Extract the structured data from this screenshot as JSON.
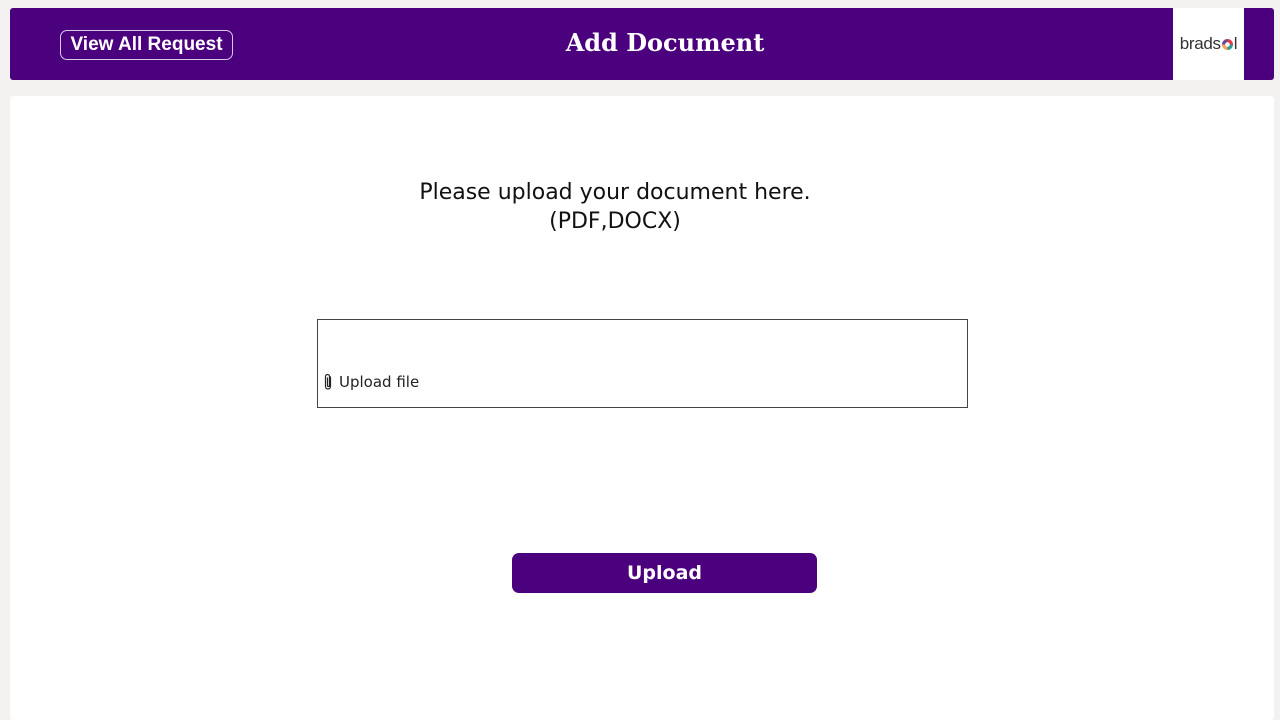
{
  "header": {
    "title": "Add Document",
    "view_all_label": "View All Request",
    "logo_text_before": "brads",
    "logo_text_after": "l",
    "background_color": "#4b007d"
  },
  "main": {
    "prompt_line1": "Please upload your document here.",
    "prompt_line2": "(PDF,DOCX)",
    "upload_file_label": "Upload file",
    "upload_button_label": "Upload"
  },
  "icons": {
    "attachment": "paperclip-icon",
    "logo_mark": "multicolor-circle-logo"
  },
  "colors": {
    "accent": "#4b007d",
    "page_background": "#f3f2f1",
    "card_background": "#ffffff"
  }
}
